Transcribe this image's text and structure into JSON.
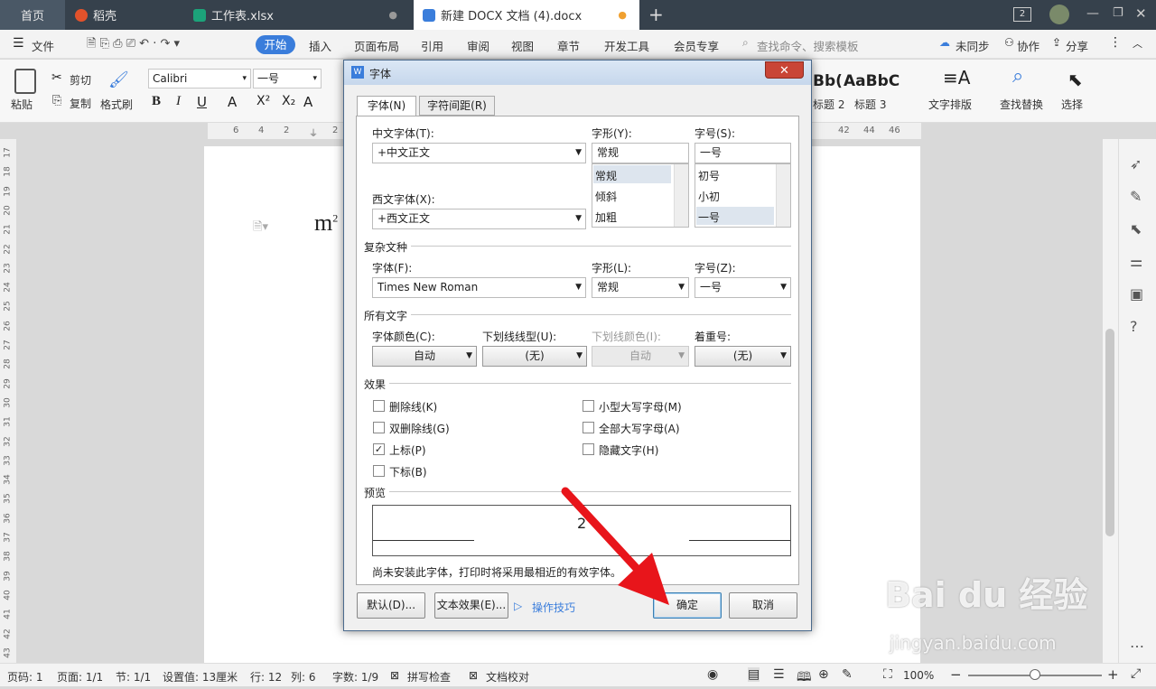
{
  "tabs": {
    "home": "首页",
    "daoke": "稻壳",
    "excel": "工作表.xlsx",
    "doc": "新建 DOCX 文档 (4).docx",
    "badge": "2"
  },
  "menu": {
    "file": "文件",
    "start": "开始",
    "insert": "插入",
    "layout": "页面布局",
    "ref": "引用",
    "review": "审阅",
    "view": "视图",
    "chapter": "章节",
    "dev": "开发工具",
    "vip": "会员专享",
    "search": "查找命令、搜索模板",
    "unsync": "未同步",
    "collab": "协作",
    "share": "分享"
  },
  "ribbon": {
    "paste": "粘贴",
    "cut": "剪切",
    "copy": "复制",
    "format_painter": "格式刷",
    "font": "Calibri",
    "size": "一号",
    "style_preview": "AaBbC",
    "style1": "标题 2",
    "style2": "标题 3",
    "typeset": "文字排版",
    "replace": "查找替换",
    "select": "选择",
    "style_prev_left": "Bb("
  },
  "ruler": {
    "h": [
      "6",
      "4",
      "2",
      "2",
      "42",
      "44",
      "46"
    ],
    "v": [
      "17",
      "18",
      "19",
      "20",
      "21",
      "22",
      "23",
      "24",
      "25",
      "26",
      "27",
      "28",
      "29",
      "30",
      "31",
      "32",
      "33",
      "34",
      "35",
      "36",
      "37",
      "38",
      "39",
      "40",
      "41",
      "42",
      "43"
    ]
  },
  "doc": {
    "text": "m",
    "sup": "2"
  },
  "dialog": {
    "title": "字体",
    "tab_font": "字体(N)",
    "tab_spacing": "字符间距(R)",
    "cn_font_label": "中文字体(T):",
    "cn_font": "+中文正文",
    "style_label": "字形(Y):",
    "style_value": "常规",
    "style_items": [
      "常规",
      "倾斜",
      "加粗"
    ],
    "size_label": "字号(S):",
    "size_value": "一号",
    "size_items": [
      "初号",
      "小初",
      "一号"
    ],
    "west_font_label": "西文字体(X):",
    "west_font": "+西文正文",
    "complex_title": "复杂文种",
    "cx_font_label": "字体(F):",
    "cx_font": "Times New Roman",
    "cx_style_label": "字形(L):",
    "cx_style": "常规",
    "cx_size_label": "字号(Z):",
    "cx_size": "一号",
    "all_text_title": "所有文字",
    "color_label": "字体颜色(C):",
    "color_value": "自动",
    "underline_label": "下划线线型(U):",
    "underline_value": "(无)",
    "underline_color_label": "下划线颜色(I):",
    "underline_color_value": "自动",
    "emphasis_label": "着重号:",
    "emphasis_value": "(无)",
    "effects_title": "效果",
    "strike": "删除线(K)",
    "dstrike": "双删除线(G)",
    "superscript": "上标(P)",
    "subscript": "下标(B)",
    "smallcaps": "小型大写字母(M)",
    "allcaps": "全部大写字母(A)",
    "hidden": "隐藏文字(H)",
    "preview_title": "预览",
    "preview_text": "2",
    "note": "尚未安装此字体，打印时将采用最相近的有效字体。",
    "default_btn": "默认(D)...",
    "text_effect_btn": "文本效果(E)...",
    "tips": "操作技巧",
    "ok": "确定",
    "cancel": "取消"
  },
  "status": {
    "page": "页码: 1",
    "pages": "页面: 1/1",
    "section": "节: 1/1",
    "setting": "设置值: 13厘米",
    "row": "行: 12",
    "col": "列: 6",
    "words": "字数: 1/9",
    "spell": "拼写检查",
    "proof": "文档校对",
    "zoom": "100%"
  },
  "watermark": {
    "brand": "Bai du 经验",
    "url": "jingyan.baidu.com"
  },
  "colors": {
    "accent": "#3a7ddb",
    "titlebar": "#36414c",
    "arrow": "#e8151b"
  }
}
